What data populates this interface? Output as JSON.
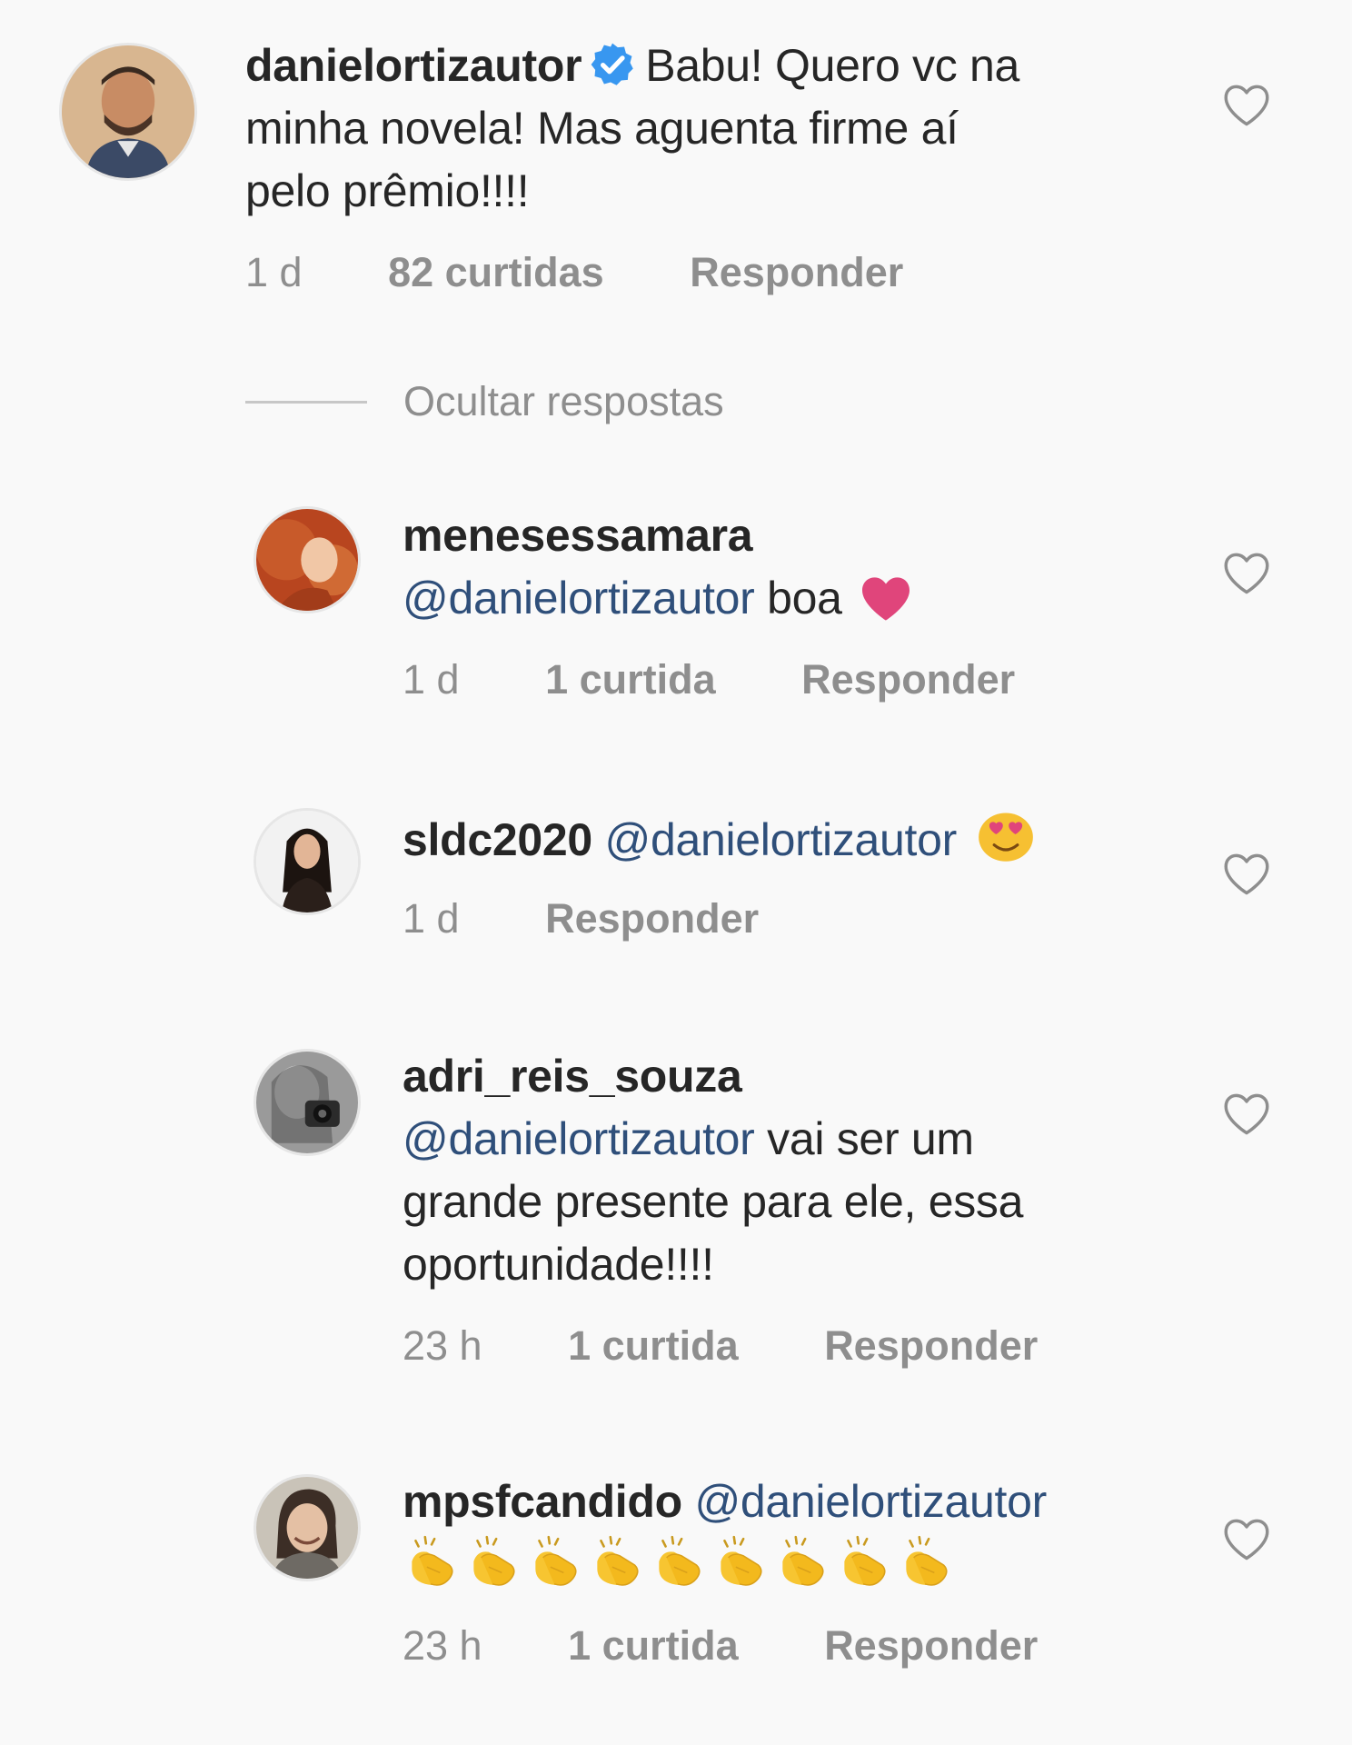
{
  "comment": {
    "username": "danielortizautor",
    "text": "Babu! Quero vc na minha novela! Mas aguenta firme aí pelo prêmio!!!!",
    "text_line1": "Babu! Quero vc na",
    "text_line2": "minha novela! Mas aguenta firme aí",
    "text_line3": "pelo prêmio!!!!",
    "time": "1 d",
    "likes": "82 curtidas",
    "reply": "Responder"
  },
  "hide_replies": "Ocultar respostas",
  "replies": [
    {
      "username": "menesessamara",
      "mention": "@danielortizautor",
      "text": "boa",
      "emoji": "heart",
      "time": "1 d",
      "likes": "1 curtida",
      "reply": "Responder"
    },
    {
      "username": "sldc2020",
      "mention": "@danielortizautor",
      "emoji": "heart-eyes",
      "time": "1 d",
      "reply": "Responder"
    },
    {
      "username": "adri_reis_souza",
      "mention": "@danielortizautor",
      "text_line1": "vai ser um",
      "text_line2": "grande presente para ele, essa",
      "text_line3": "oportunidade!!!!",
      "time": "23 h",
      "likes": "1 curtida",
      "reply": "Responder"
    },
    {
      "username": "mpsfcandido",
      "mention": "@danielortizautor",
      "emoji": "clapping-hands",
      "emoji_count": 9,
      "time": "23 h",
      "likes": "1 curtida",
      "reply": "Responder"
    }
  ],
  "colors": {
    "background": "#f9f9f9",
    "text": "#262626",
    "secondary": "#8e8e8e",
    "mention": "#2f4f7a",
    "verified": "#3897f0",
    "heart_emoji": "#e0457b"
  }
}
